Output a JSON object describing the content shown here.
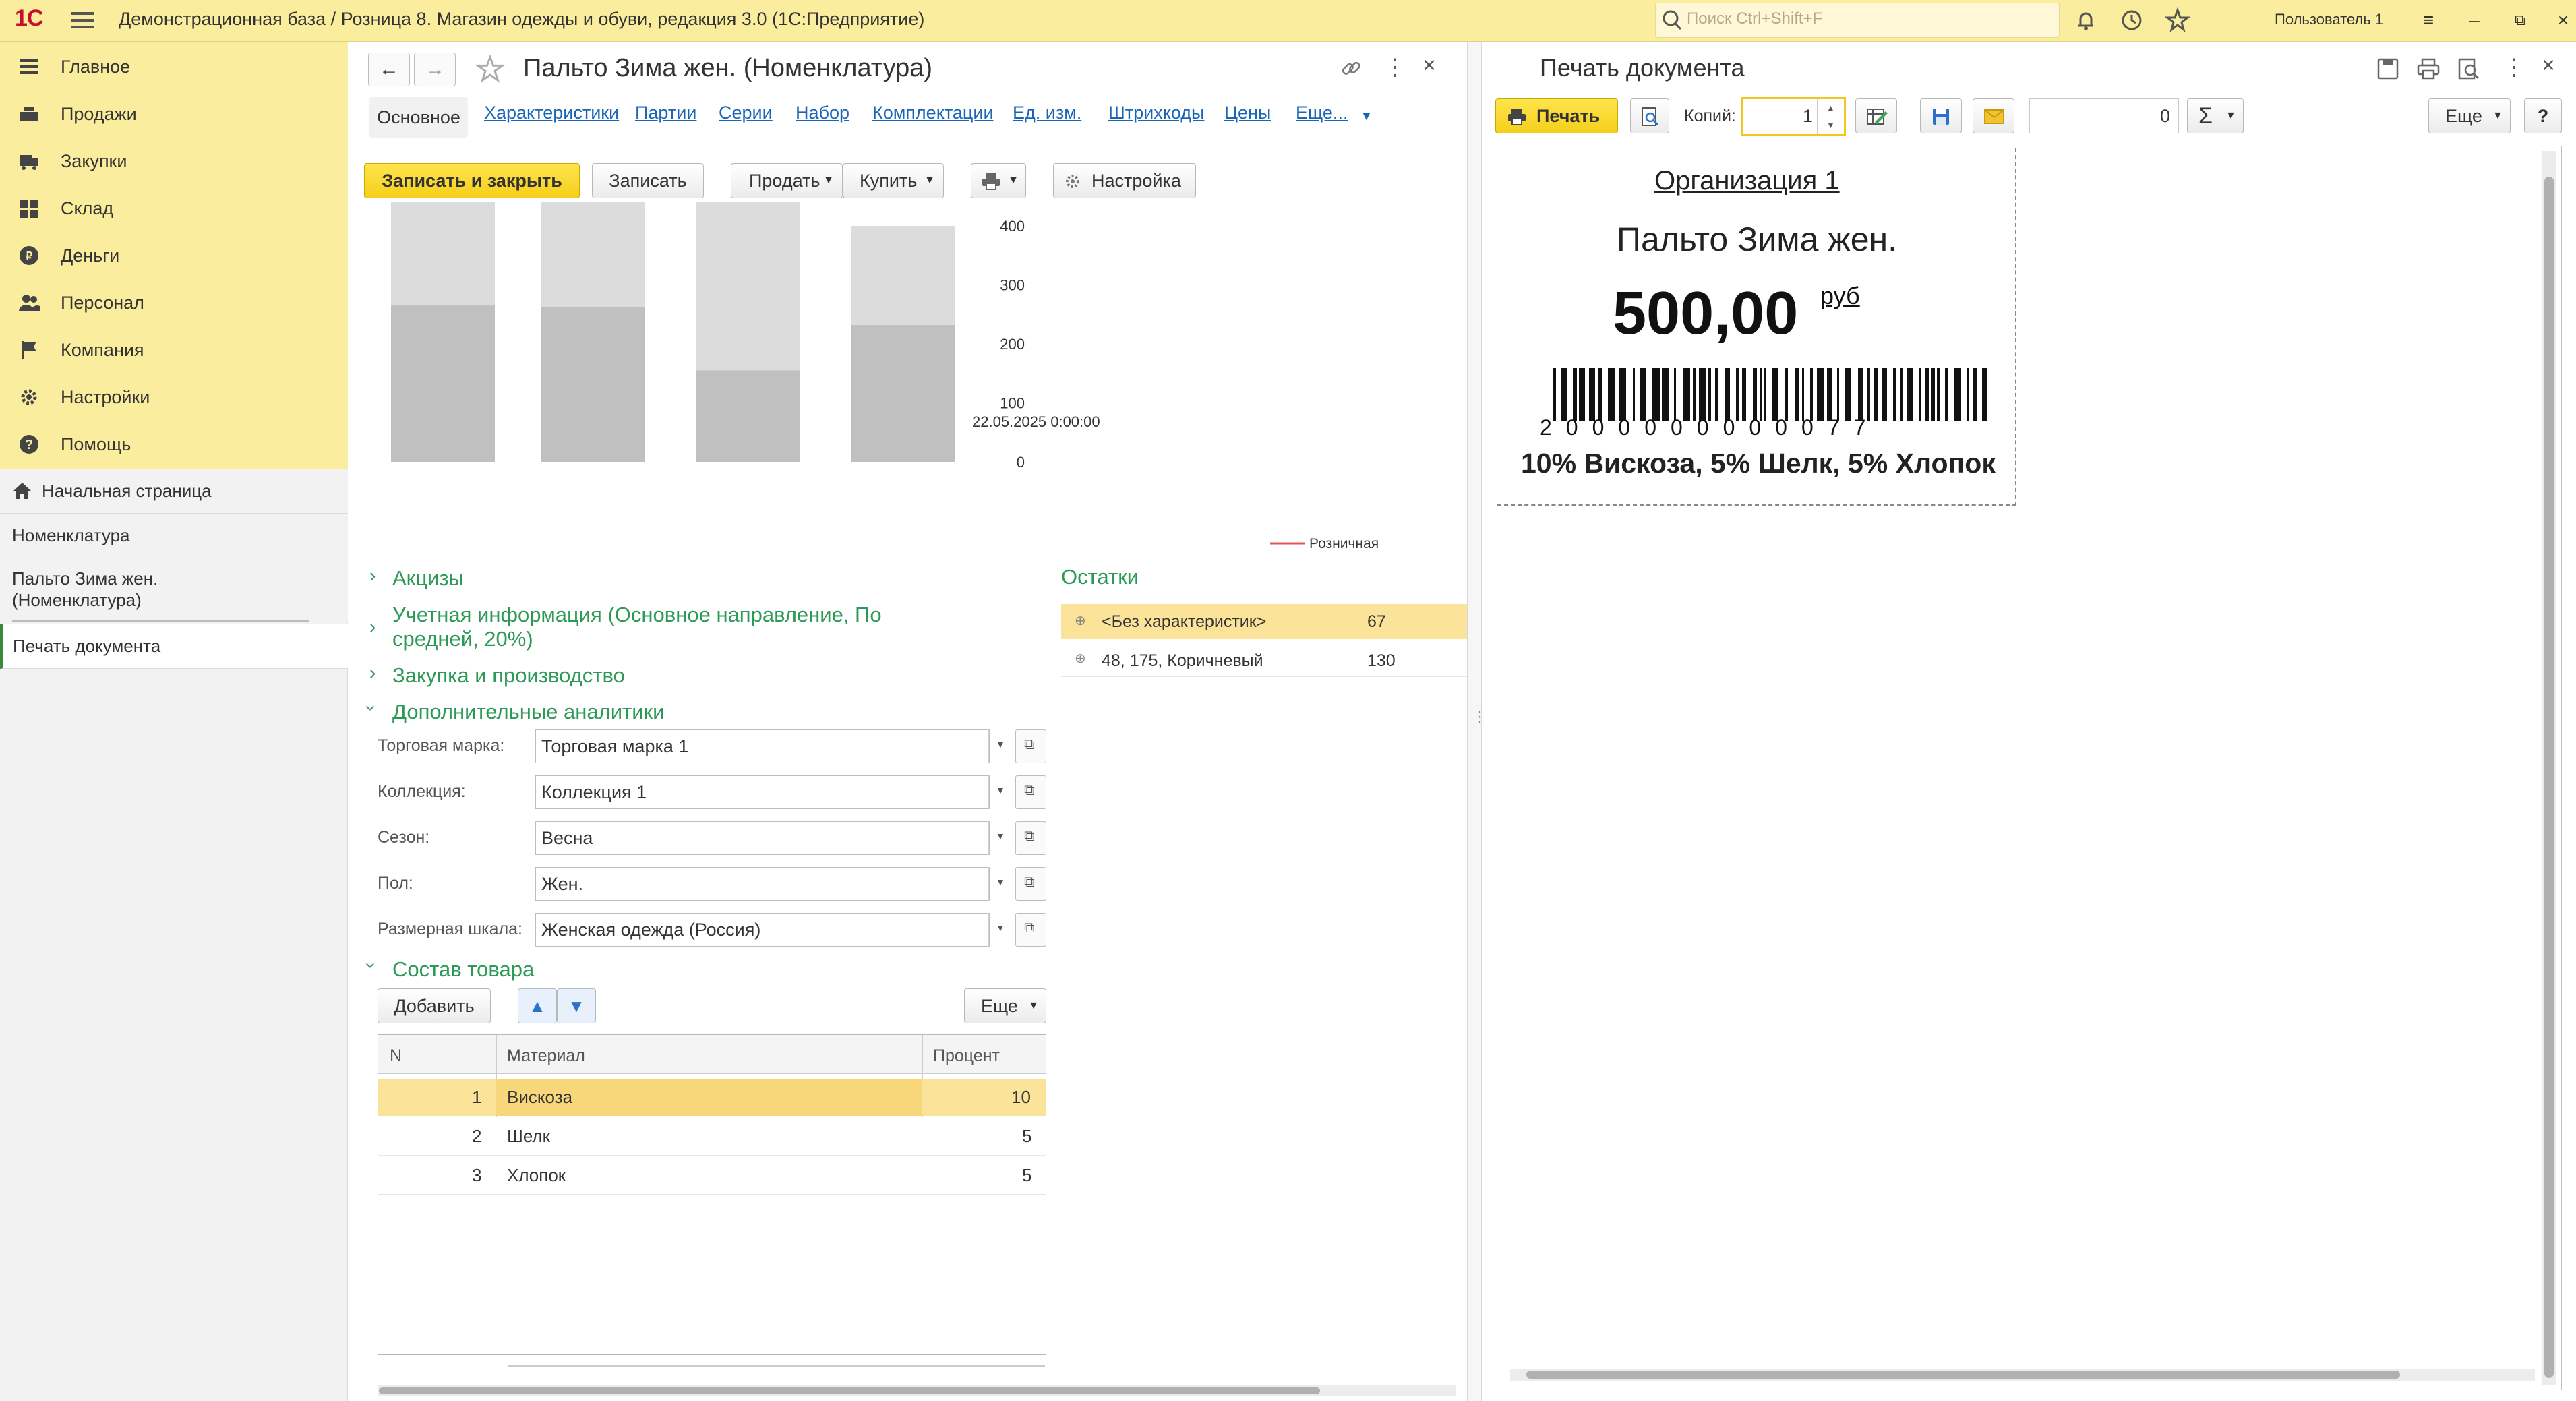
{
  "window": {
    "logo": "1С",
    "title": "Демонстрационная база / Розница 8. Магазин одежды и обуви, редакция 3.0  (1С:Предприятие)",
    "search_placeholder": "Поиск Ctrl+Shift+F",
    "user": "Пользователь 1"
  },
  "sidebar": {
    "sections": [
      {
        "label": "Главное",
        "icon": "menu-icon"
      },
      {
        "label": "Продажи",
        "icon": "cash-register-icon"
      },
      {
        "label": "Закупки",
        "icon": "truck-icon"
      },
      {
        "label": "Склад",
        "icon": "warehouse-icon"
      },
      {
        "label": "Деньги",
        "icon": "money-icon"
      },
      {
        "label": "Персонал",
        "icon": "people-icon"
      },
      {
        "label": "Компания",
        "icon": "flag-icon"
      },
      {
        "label": "Настройки",
        "icon": "gear-icon"
      },
      {
        "label": "Помощь",
        "icon": "help-icon"
      }
    ],
    "open_windows": [
      {
        "label": "Начальная страница"
      },
      {
        "label": "Номенклатура"
      },
      {
        "label": "Пальто Зима жен.",
        "label2": "(Номенклатура)"
      },
      {
        "label": "Печать документа"
      }
    ]
  },
  "form": {
    "title": "Пальто Зима жен. (Номенклатура)",
    "tabs": [
      "Основное",
      "Характеристики",
      "Партии",
      "Серии",
      "Набор",
      "Комплектации",
      "Ед. изм.",
      "Штрихкоды",
      "Цены",
      "Еще..."
    ],
    "buttons": {
      "save_close": "Записать и закрыть",
      "save": "Записать",
      "sell": "Продать",
      "buy": "Купить",
      "settings": "Настройка"
    }
  },
  "chart_data": {
    "type": "bar",
    "ylim": [
      0,
      400
    ],
    "yticks": [
      "400",
      "300",
      "200",
      "100",
      "0"
    ],
    "xlabel": "22.05.2025 0:00:00",
    "legend": [
      {
        "name": "Розничная",
        "color": "#e05a5a"
      }
    ],
    "bars": [
      {
        "total": 490,
        "lower": 265
      },
      {
        "total": 490,
        "lower": 262
      },
      {
        "total": 464,
        "lower": 155
      },
      {
        "total": 400,
        "lower": 232
      }
    ]
  },
  "sections": {
    "excise": "Акцизы",
    "accounting": "Учетная информация (Основное направление, По",
    "accounting2": "средней, 20%)",
    "purchase": "Закупка и производство",
    "analytics": "Дополнительные аналитики",
    "composition": "Состав товара"
  },
  "analytics_fields": [
    {
      "label": "Торговая марка:",
      "value": "Торговая марка 1"
    },
    {
      "label": "Коллекция:",
      "value": "Коллекция 1"
    },
    {
      "label": "Сезон:",
      "value": "Весна"
    },
    {
      "label": "Пол:",
      "value": "Жен."
    },
    {
      "label": "Размерная шкала:",
      "value": "Женская одежда (Россия)"
    }
  ],
  "remains": {
    "title": "Остатки",
    "rows": [
      {
        "name": "<Без характеристик>",
        "qty": "67"
      },
      {
        "name": "48, 175, Коричневый",
        "qty": "130"
      }
    ]
  },
  "composition": {
    "add": "Добавить",
    "more": "Еще",
    "headers": [
      "N",
      "Материал",
      "Процент"
    ],
    "rows": [
      {
        "n": "1",
        "material": "Вискоза",
        "percent": "10"
      },
      {
        "n": "2",
        "material": "Шелк",
        "percent": "5"
      },
      {
        "n": "3",
        "material": "Хлопок",
        "percent": "5"
      }
    ]
  },
  "print": {
    "title": "Печать документа",
    "print_btn": "Печать",
    "copies_label": "Копий:",
    "copies_value": "1",
    "sum_value": "0",
    "more": "Еще",
    "help": "?",
    "label": {
      "org": "Организация 1",
      "product": "Пальто  Зима жен.",
      "price": "500,00",
      "currency": "руб",
      "barcode": "2000000000077",
      "composition": "10% Вискоза, 5% Шелк, 5% Хлопок"
    }
  }
}
